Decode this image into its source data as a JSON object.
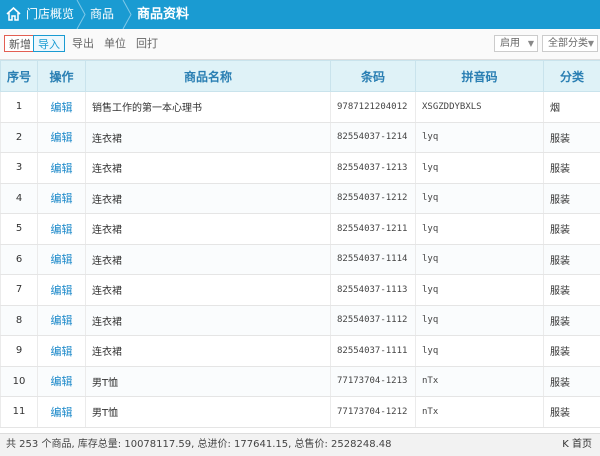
{
  "breadcrumb": {
    "home": "门店概览",
    "level2": "商品",
    "current": "商品资料"
  },
  "toolbar": {
    "add": "新增",
    "import": "导入",
    "export": "导出",
    "unit": "单位",
    "print": "回打",
    "status_select": "启用",
    "category_select": "全部分类"
  },
  "table": {
    "headers": {
      "idx": "序号",
      "op": "操作",
      "name": "商品名称",
      "barcode": "条码",
      "pinyin": "拼音码",
      "category": "分类"
    },
    "rows": [
      {
        "idx": "1",
        "op": "编辑",
        "name": "销售工作的第一本心理书",
        "barcode": "9787121204012",
        "pinyin": "XSGZDDYBXLS",
        "category": "烟"
      },
      {
        "idx": "2",
        "op": "编辑",
        "name": "连衣裙",
        "barcode": "82554037-1214",
        "pinyin": "lyq",
        "category": "服装"
      },
      {
        "idx": "3",
        "op": "编辑",
        "name": "连衣裙",
        "barcode": "82554037-1213",
        "pinyin": "lyq",
        "category": "服装"
      },
      {
        "idx": "4",
        "op": "编辑",
        "name": "连衣裙",
        "barcode": "82554037-1212",
        "pinyin": "lyq",
        "category": "服装"
      },
      {
        "idx": "5",
        "op": "编辑",
        "name": "连衣裙",
        "barcode": "82554037-1211",
        "pinyin": "lyq",
        "category": "服装"
      },
      {
        "idx": "6",
        "op": "编辑",
        "name": "连衣裙",
        "barcode": "82554037-1114",
        "pinyin": "lyq",
        "category": "服装"
      },
      {
        "idx": "7",
        "op": "编辑",
        "name": "连衣裙",
        "barcode": "82554037-1113",
        "pinyin": "lyq",
        "category": "服装"
      },
      {
        "idx": "8",
        "op": "编辑",
        "name": "连衣裙",
        "barcode": "82554037-1112",
        "pinyin": "lyq",
        "category": "服装"
      },
      {
        "idx": "9",
        "op": "编辑",
        "name": "连衣裙",
        "barcode": "82554037-1111",
        "pinyin": "lyq",
        "category": "服装"
      },
      {
        "idx": "10",
        "op": "编辑",
        "name": "男T恤",
        "barcode": "77173704-1213",
        "pinyin": "nTx",
        "category": "服装"
      },
      {
        "idx": "11",
        "op": "编辑",
        "name": "男T恤",
        "barcode": "77173704-1212",
        "pinyin": "nTx",
        "category": "服装"
      }
    ]
  },
  "footer": {
    "summary": "共 253 个商品, 库存总量: 10078117.59, 总进价: 177641.15, 总售价: 2528248.48",
    "first_page": "K 首页"
  },
  "colors": {
    "header_bg": "#1a9bd2",
    "table_header_bg": "#dff2f7",
    "link": "#1a88c9",
    "add_border": "#e35e52"
  },
  "icons": {
    "home": "home-icon",
    "select_arrow": "chevron-down-icon"
  }
}
